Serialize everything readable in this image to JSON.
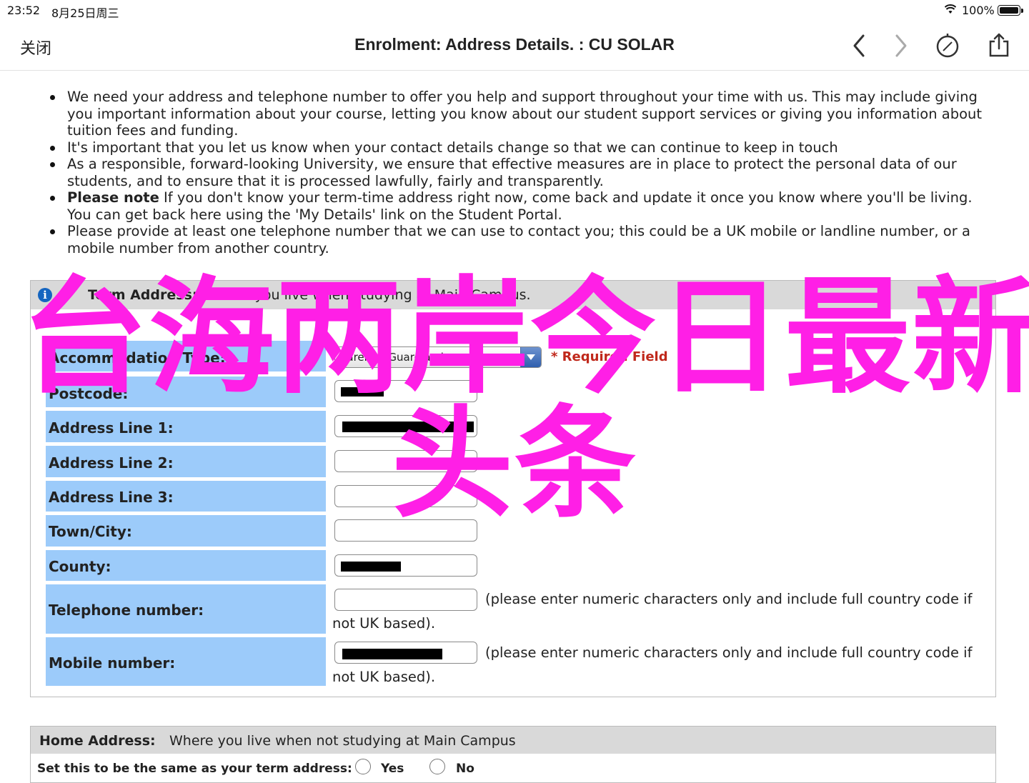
{
  "status_bar": {
    "time": "23:52",
    "date": "8月25日周三",
    "battery": "100%"
  },
  "nav": {
    "close_label": "关闭",
    "title": "Enrolment: Address Details. : CU SOLAR",
    "icons": [
      "chevron-left-icon",
      "chevron-right-icon",
      "compass-icon",
      "share-icon"
    ]
  },
  "intro": {
    "items": [
      "We need your address and telephone number to offer you help and support throughout your time with us. This may include giving you important information about your course, letting you know about our student support services or giving you information about tuition fees and funding.",
      "It's important that you let us know when your contact details change so that we can continue to keep in touch",
      "As a responsible, forward-looking University, we ensure that effective measures are in place to protect the personal data of our students, and to ensure that it is processed lawfully, fairly and transparently.",
      "If you don't know your term-time address right now, come back and update it once you know where you'll be living. You can get back here using the 'My Details' link on the Student Portal.",
      "Please provide at least one telephone number that we can use to contact you; this could be a UK mobile or landline number, or a mobile number from another country."
    ],
    "note_bold": "Please note"
  },
  "term_address": {
    "header_label": "Term Address:",
    "header_desc": "Where you live when studying at Main Campus.",
    "accommodation_label": "Accommodation Type:",
    "accommodation_value": "Parental/Guardian home",
    "required_text": "* Required Field",
    "postcode_label": "Postcode:",
    "line1_label": "Address Line 1:",
    "line2_label": "Address Line 2:",
    "line3_label": "Address Line 3:",
    "town_label": "Town/City:",
    "county_label": "County:",
    "telephone_label": "Telephone number:",
    "mobile_label": "Mobile number:",
    "hint_line1": "(please enter numeric characters only and include full country code if",
    "hint_line2": "not UK based)."
  },
  "home_address": {
    "header_label": "Home Address:",
    "header_desc": "Where you live when not studying at Main Campus",
    "same_label": "Set this to be the same as your term address:",
    "yes_label": "Yes",
    "no_label": "No"
  },
  "watermark": {
    "line1": "台海两岸今日最新",
    "line2": "头条",
    "color": "#ff1fe6"
  },
  "colors": {
    "label_bg": "#9ccbfa",
    "header_bg": "#d9d9d9",
    "required": "#c0281b"
  }
}
